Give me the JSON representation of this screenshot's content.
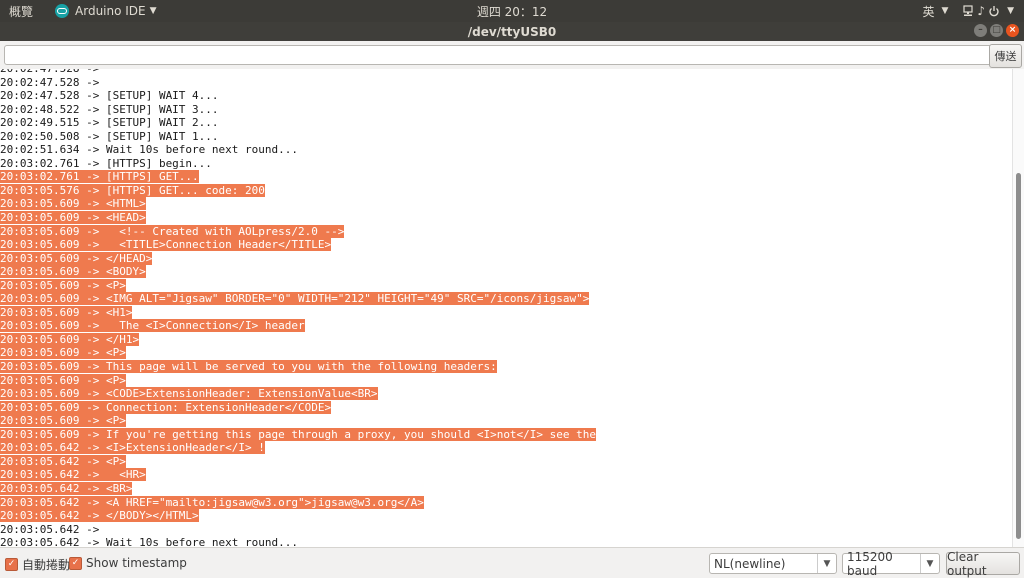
{
  "topbar": {
    "activities": "概覽",
    "app_name": "Arduino IDE",
    "clock": "週四 20：12",
    "input_method": "英"
  },
  "window": {
    "title": "/dev/ttyUSB0"
  },
  "send": {
    "value": "",
    "button_label": "傳送"
  },
  "console": {
    "lines": [
      {
        "ts": "20:02:47.528",
        "msg": "",
        "sel": false
      },
      {
        "ts": "20:02:47.528",
        "msg": "",
        "sel": false
      },
      {
        "ts": "20:02:47.528",
        "msg": "[SETUP] WAIT 4...",
        "sel": false
      },
      {
        "ts": "20:02:48.522",
        "msg": "[SETUP] WAIT 3...",
        "sel": false
      },
      {
        "ts": "20:02:49.515",
        "msg": "[SETUP] WAIT 2...",
        "sel": false
      },
      {
        "ts": "20:02:50.508",
        "msg": "[SETUP] WAIT 1...",
        "sel": false
      },
      {
        "ts": "20:02:51.634",
        "msg": "Wait 10s before next round...",
        "sel": false
      },
      {
        "ts": "20:03:02.761",
        "msg": "[HTTPS] begin...",
        "sel": false
      },
      {
        "ts": "20:03:02.761",
        "msg": "[HTTPS] GET...",
        "sel": true
      },
      {
        "ts": "20:03:05.576",
        "msg": "[HTTPS] GET... code: 200",
        "sel": true
      },
      {
        "ts": "20:03:05.609",
        "msg": "<HTML>",
        "sel": true
      },
      {
        "ts": "20:03:05.609",
        "msg": "<HEAD>",
        "sel": true
      },
      {
        "ts": "20:03:05.609",
        "msg": "  <!-- Created with AOLpress/2.0 -->",
        "sel": true
      },
      {
        "ts": "20:03:05.609",
        "msg": "  <TITLE>Connection Header</TITLE>",
        "sel": true
      },
      {
        "ts": "20:03:05.609",
        "msg": "</HEAD>",
        "sel": true
      },
      {
        "ts": "20:03:05.609",
        "msg": "<BODY>",
        "sel": true
      },
      {
        "ts": "20:03:05.609",
        "msg": "<P>",
        "sel": true
      },
      {
        "ts": "20:03:05.609",
        "msg": "<IMG ALT=\"Jigsaw\" BORDER=\"0\" WIDTH=\"212\" HEIGHT=\"49\" SRC=\"/icons/jigsaw\">",
        "sel": true
      },
      {
        "ts": "20:03:05.609",
        "msg": "<H1>",
        "sel": true
      },
      {
        "ts": "20:03:05.609",
        "msg": "  The <I>Connection</I> header",
        "sel": true
      },
      {
        "ts": "20:03:05.609",
        "msg": "</H1>",
        "sel": true
      },
      {
        "ts": "20:03:05.609",
        "msg": "<P>",
        "sel": true
      },
      {
        "ts": "20:03:05.609",
        "msg": "This page will be served to you with the following headers:",
        "sel": true
      },
      {
        "ts": "20:03:05.609",
        "msg": "<P>",
        "sel": true
      },
      {
        "ts": "20:03:05.609",
        "msg": "<CODE>ExtensionHeader: ExtensionValue<BR>",
        "sel": true
      },
      {
        "ts": "20:03:05.609",
        "msg": "Connection: ExtensionHeader</CODE>",
        "sel": true
      },
      {
        "ts": "20:03:05.609",
        "msg": "<P>",
        "sel": true
      },
      {
        "ts": "20:03:05.609",
        "msg": "If you're getting this page through a proxy, you should <I>not</I> see the",
        "sel": true
      },
      {
        "ts": "20:03:05.642",
        "msg": "<I>ExtensionHeader</I> !",
        "sel": true
      },
      {
        "ts": "20:03:05.642",
        "msg": "<P>",
        "sel": true
      },
      {
        "ts": "20:03:05.642",
        "msg": "  <HR>",
        "sel": true
      },
      {
        "ts": "20:03:05.642",
        "msg": "<BR>",
        "sel": true
      },
      {
        "ts": "20:03:05.642",
        "msg": "<A HREF=\"mailto:jigsaw@w3.org\">jigsaw@w3.org</A>",
        "sel": true
      },
      {
        "ts": "20:03:05.642",
        "msg": "</BODY></HTML>",
        "sel": true
      },
      {
        "ts": "20:03:05.642",
        "msg": "",
        "sel": false
      },
      {
        "ts": "20:03:05.642",
        "msg": "Wait 10s before next round...",
        "sel": false
      }
    ]
  },
  "bottombar": {
    "autoscroll_label": "自動捲動",
    "autoscroll_checked": true,
    "timestamp_label": "Show timestamp",
    "timestamp_checked": true,
    "line_ending": "NL(newline)",
    "baud": "115200 baud",
    "clear_label": "Clear output"
  }
}
